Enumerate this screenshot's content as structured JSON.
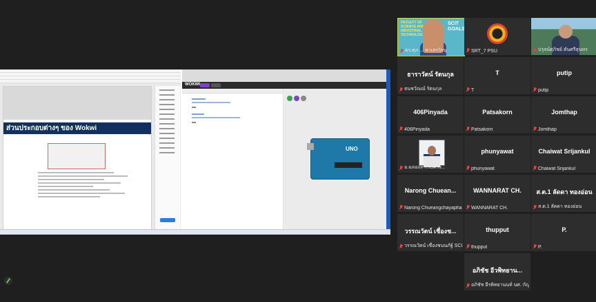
{
  "shared_screen": {
    "slide_title": "ส่วนประกอบต่างๆ ของ Wokwi",
    "wokwi_logo": "WOKWI",
    "board_label": "UNO"
  },
  "participants": [
    {
      "name": "",
      "label": "ดร.ศุภ ... พาเสรวิรนุ",
      "video": "fst"
    },
    {
      "name": "",
      "label": "SRT_7 PSU",
      "video": "logo"
    },
    {
      "name": "",
      "label": "ปรุจน์ศุภิชย์ ตันศรีสุนทร",
      "video": "man"
    },
    {
      "name": "ธาราวัตน์ รัตนกุล",
      "label": "ธนชวัณณ์ รัตนกุล"
    },
    {
      "name": "T",
      "label": "T"
    },
    {
      "name": "putip",
      "label": "putip"
    },
    {
      "name": "406Pinyada",
      "label": "406Pinyada"
    },
    {
      "name": "Patsakorn",
      "label": "Patsakorn"
    },
    {
      "name": "Jomthap",
      "label": "Jomthap"
    },
    {
      "name": "",
      "label": "อ.ฉลองส-กรบครง...",
      "video": "officer"
    },
    {
      "name": "phunyawat",
      "label": "phunyawat"
    },
    {
      "name": "Chaiwat Srijankul",
      "label": "Chaiwat Srijankul"
    },
    {
      "name": "Narong  Chuean...",
      "label": "Narong Chueangchayaphan"
    },
    {
      "name": "WANNARAT CH.",
      "label": "WANNARAT CH."
    },
    {
      "name": "ส.ต.1 ลัดดา ทองอ่อน",
      "label": "ส.ต.1 ลัดดา ทองอ่อน"
    },
    {
      "name": "วรรณวัตน์ เชื่องช...",
      "label": "วรรณวัตน์ เชื่องชนนภัฐ์ SCIT"
    },
    {
      "name": "thupput",
      "label": "thupput"
    },
    {
      "name": "P.",
      "label": "P."
    },
    {
      "name": "อภิชัช อีวพิทยาน...",
      "label": "อภิชัช อีรพิทยานนท์ นศ. กัญญูลด..."
    }
  ],
  "video_overlay": {
    "fst_text": "FACULTY OF SCIENCE AND INDUSTRIAL TECHNOLOGY",
    "fst_goals": "SCIT GOALS"
  },
  "icons": {
    "mic_muted": "mic-muted-icon",
    "pen": "pen-icon"
  }
}
